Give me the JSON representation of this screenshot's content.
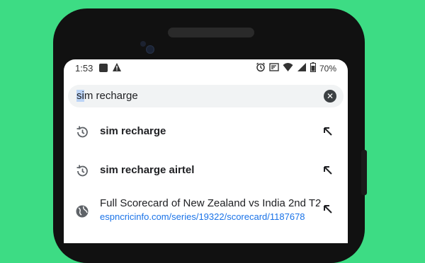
{
  "status_bar": {
    "time": "1:53",
    "battery": "70%"
  },
  "search": {
    "query_selected": "si",
    "query_rest": "m recharge",
    "clear_icon": "close-circle-icon"
  },
  "suggestions": [
    {
      "type": "history",
      "icon": "history-icon",
      "title": "sim recharge"
    },
    {
      "type": "history",
      "icon": "history-icon",
      "title": "sim recharge airtel"
    },
    {
      "type": "site",
      "icon": "globe-icon",
      "title": "Full Scorecard of New Zealand vs India 2nd T2",
      "url": "espncricinfo.com/series/19322/scorecard/1187678"
    }
  ],
  "colors": {
    "background": "#3ddc84",
    "url_blue": "#1a73e8",
    "selection": "#bcd4f6"
  }
}
